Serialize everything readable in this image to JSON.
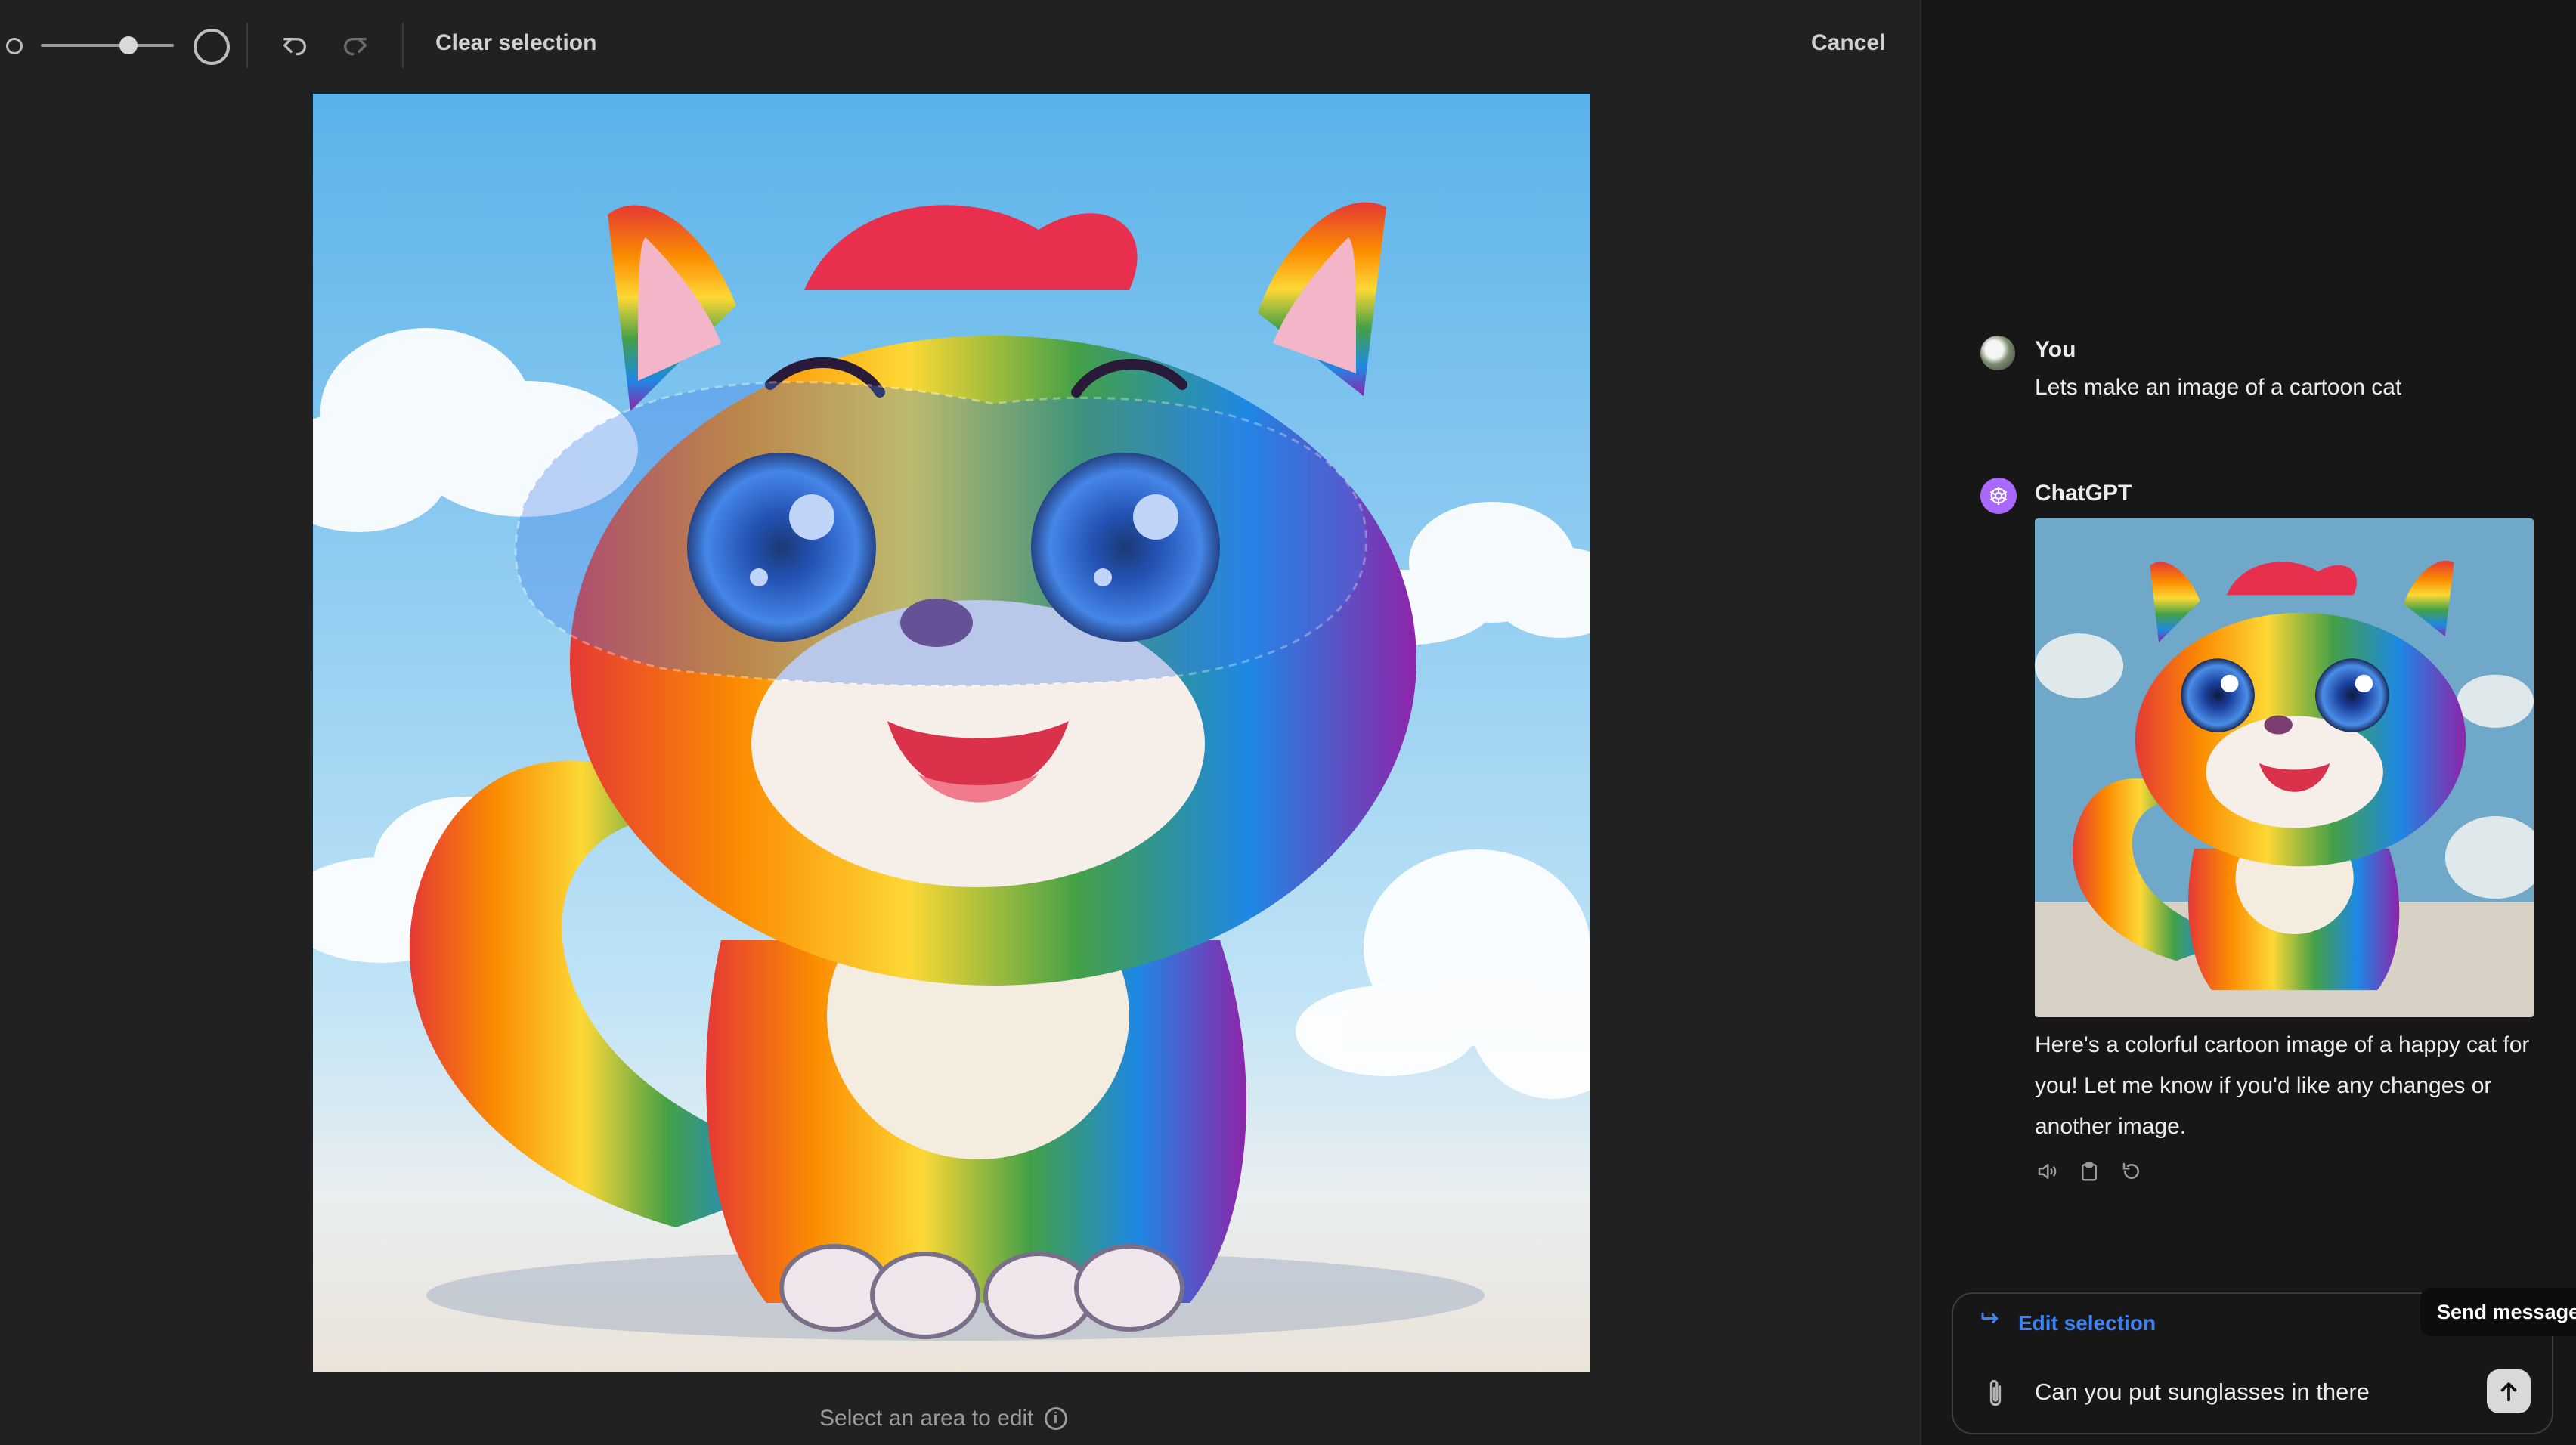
{
  "toolbar": {
    "clear_selection_label": "Clear selection",
    "cancel_label": "Cancel",
    "brush_size_fraction": 0.66
  },
  "canvas": {
    "hint": "Select an area to edit",
    "info_icon_glyph": "i"
  },
  "chat": {
    "messages": [
      {
        "author": "You",
        "text": "Lets make an image of a cartoon cat"
      },
      {
        "author": "ChatGPT",
        "text": "Here's a colorful cartoon image of a happy cat for you! Let me know if you'd like any changes or another image."
      }
    ]
  },
  "composer": {
    "edit_selection_label": "Edit selection",
    "input_value": "Can you put sunglasses in there",
    "send_tooltip": "Send message"
  },
  "colors": {
    "accent_blue": "#3b82f6",
    "gpt_avatar": "#ab68ff",
    "background": "#212121",
    "sidebar_background": "#171717"
  },
  "icons": {
    "brush_small": "circle-small-icon",
    "brush_large": "circle-large-icon",
    "undo": "undo-icon",
    "redo": "redo-icon",
    "info": "info-icon",
    "speaker": "speaker-icon",
    "copy": "clipboard-icon",
    "regenerate": "refresh-icon",
    "edit_selection": "arrow-turn-icon",
    "attach": "paperclip-icon",
    "send": "arrow-up-icon"
  }
}
